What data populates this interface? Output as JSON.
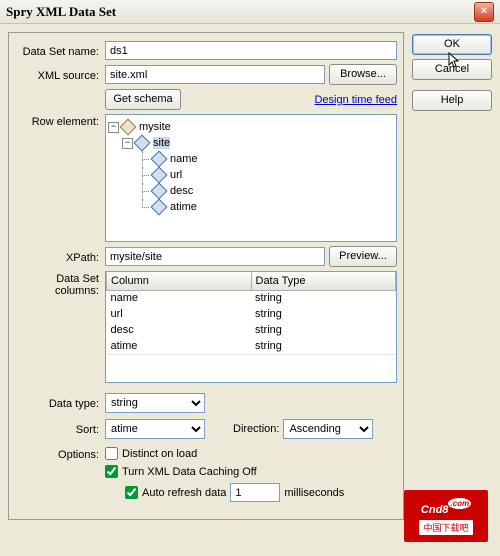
{
  "title": "Spry XML Data Set",
  "buttons": {
    "ok": "OK",
    "cancel": "Cancel",
    "help": "Help",
    "browse": "Browse...",
    "get_schema": "Get schema",
    "preview": "Preview...",
    "design_feed": "Design time feed"
  },
  "labels": {
    "data_set_name": "Data Set name:",
    "xml_source": "XML source:",
    "row_element": "Row element:",
    "xpath": "XPath:",
    "data_set_columns": "Data Set columns:",
    "data_type": "Data type:",
    "sort": "Sort:",
    "direction": "Direction:",
    "options": "Options:",
    "distinct": "Distinct on load",
    "caching": "Turn XML Data Caching Off",
    "auto_refresh": "Auto refresh data",
    "milliseconds": "milliseconds"
  },
  "columns": {
    "column": "Column",
    "data_type": "Data Type"
  },
  "values": {
    "data_set_name": "ds1",
    "xml_source": "site.xml",
    "xpath": "mysite/site",
    "data_type": "string",
    "sort": "atime",
    "direction": "Ascending",
    "distinct": false,
    "caching": true,
    "auto_refresh": true,
    "refresh_ms": "1"
  },
  "tree": {
    "root": "mysite",
    "child": "site",
    "leaves": [
      "name",
      "url",
      "desc",
      "atime"
    ]
  },
  "table_rows": [
    {
      "col": "name",
      "type": "string"
    },
    {
      "col": "url",
      "type": "string"
    },
    {
      "col": "desc",
      "type": "string"
    },
    {
      "col": "atime",
      "type": "string"
    }
  ],
  "select_options": {
    "data_type": [
      "string"
    ],
    "sort": [
      "atime"
    ],
    "direction": [
      "Ascending"
    ]
  },
  "watermark": {
    "logo": "Cnd8",
    "com": ".com",
    "sub": "中国下载吧"
  }
}
